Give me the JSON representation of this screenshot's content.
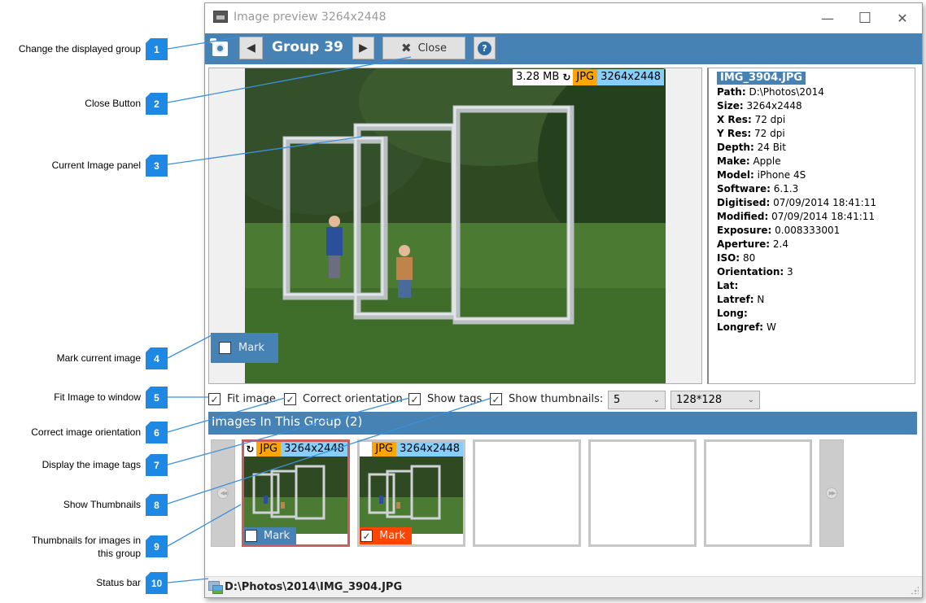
{
  "window": {
    "title": "Image preview 3264x2448",
    "minimize_glyph": "—",
    "maximize_glyph": "☐",
    "close_glyph": "✕"
  },
  "toolbar": {
    "group_label": "Group 39",
    "prev_glyph": "◀",
    "next_glyph": "▶",
    "close_glyph": "✖",
    "close_label": "Close",
    "help_glyph": "?"
  },
  "current_image": {
    "file_size": "3.28 MB",
    "rotate_glyph": "↻",
    "format": "JPG",
    "dimensions": "3264x2448",
    "mark_label": "Mark",
    "mark_checked": false
  },
  "info": {
    "filename": "IMG_3904.JPG",
    "rows": [
      {
        "key": "Path:",
        "value": "D:\\Photos\\2014"
      },
      {
        "key": "Size:",
        "value": "3264x2448"
      },
      {
        "key": "X Res:",
        "value": "72 dpi"
      },
      {
        "key": "Y Res:",
        "value": "72 dpi"
      },
      {
        "key": "Depth:",
        "value": "24 Bit"
      },
      {
        "key": "Make:",
        "value": "Apple"
      },
      {
        "key": "Model:",
        "value": "iPhone 4S"
      },
      {
        "key": "Software:",
        "value": "6.1.3"
      },
      {
        "key": "Digitised:",
        "value": "07/09/2014 18:41:11"
      },
      {
        "key": "Modified:",
        "value": "07/09/2014 18:41:11"
      },
      {
        "key": "Exposure:",
        "value": "0.008333001"
      },
      {
        "key": "Aperture:",
        "value": "2.4"
      },
      {
        "key": "ISO:",
        "value": "80"
      },
      {
        "key": "Orientation:",
        "value": "3"
      },
      {
        "key": "Lat:",
        "value": ""
      },
      {
        "key": "Latref:",
        "value": "N"
      },
      {
        "key": "Long:",
        "value": ""
      },
      {
        "key": "Longref:",
        "value": "W"
      }
    ]
  },
  "options": {
    "fit_image": {
      "label": "Fit image",
      "checked": true
    },
    "correct_orientation": {
      "label": "Correct orientation",
      "checked": true
    },
    "show_tags": {
      "label": "Show tags",
      "checked": true
    },
    "show_thumbnails": {
      "label": "Show thumbnails:",
      "checked": true
    },
    "thumb_count": "5",
    "thumb_size": "128*128",
    "check_glyph": "✓",
    "chevron_glyph": "⌄"
  },
  "group": {
    "header": "Images In This Group (2)",
    "thumbnails": [
      {
        "format": "JPG",
        "dimensions": "3264x2448",
        "rotated": true,
        "mark_label": "Mark",
        "marked": false,
        "selected": true
      },
      {
        "format": "JPG",
        "dimensions": "3264x2448",
        "rotated": false,
        "mark_label": "Mark",
        "marked": true,
        "selected": false
      }
    ],
    "prev_glyph": "◀◀",
    "next_glyph": "▶▶"
  },
  "status": {
    "path": "D:\\Photos\\2014\\IMG_3904.JPG"
  },
  "colors": {
    "accent": "#4682b4",
    "tag_format": "#ffa500",
    "tag_dims": "#87cefa",
    "marked": "#ff4500",
    "selected_border": "#cd5c5c",
    "callout": "#1e88e5"
  },
  "callouts": [
    {
      "n": "1",
      "label": "Change the displayed group"
    },
    {
      "n": "2",
      "label": "Close Button"
    },
    {
      "n": "3",
      "label": "Current Image panel"
    },
    {
      "n": "4",
      "label": "Mark current image"
    },
    {
      "n": "5",
      "label": "Fit Image to window"
    },
    {
      "n": "6",
      "label": "Correct image orientation"
    },
    {
      "n": "7",
      "label": "Display the image tags"
    },
    {
      "n": "8",
      "label": "Show Thumbnails"
    },
    {
      "n": "9",
      "label": "Thumbnails for images in this group"
    },
    {
      "n": "10",
      "label": "Status bar"
    }
  ]
}
